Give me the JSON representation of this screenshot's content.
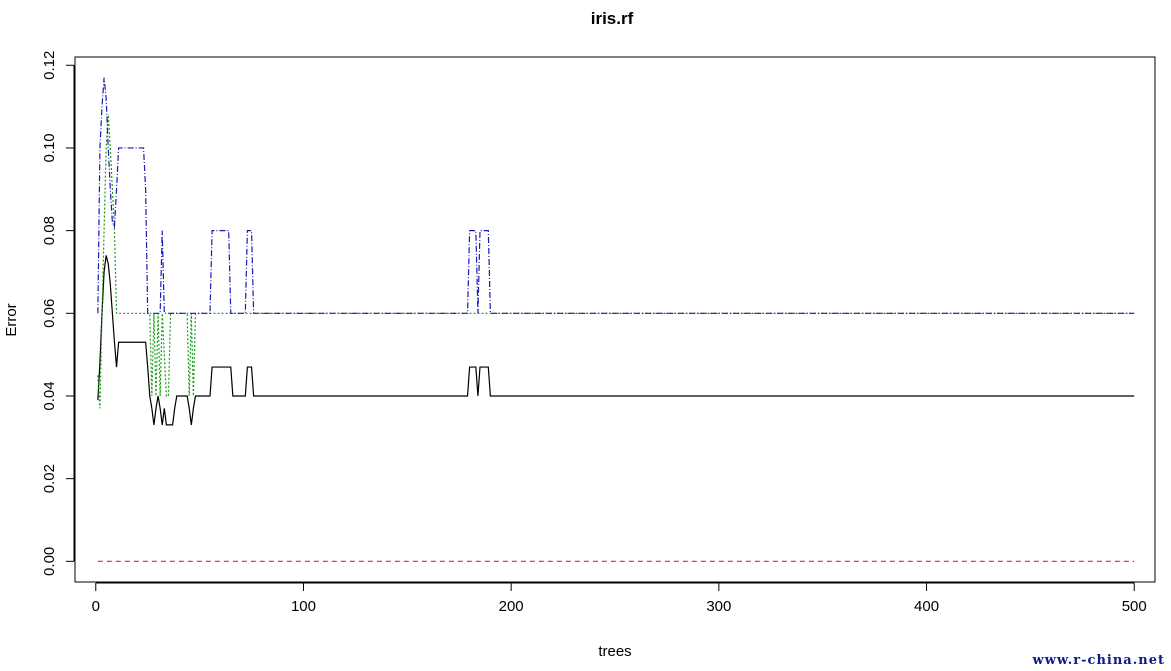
{
  "chart_data": {
    "type": "line",
    "title": "iris.rf",
    "xlabel": "trees",
    "ylabel": "Error",
    "xlim": [
      -10,
      510
    ],
    "ylim": [
      -0.005,
      0.122
    ],
    "xticks": [
      0,
      100,
      200,
      300,
      400,
      500
    ],
    "yticks": [
      0.0,
      0.02,
      0.04,
      0.06,
      0.08,
      0.1,
      0.12
    ],
    "grid": false,
    "series": [
      {
        "color": "#000000",
        "dash": "",
        "points": [
          [
            1,
            0.039
          ],
          [
            2,
            0.048
          ],
          [
            3,
            0.06
          ],
          [
            4,
            0.07
          ],
          [
            5,
            0.074
          ],
          [
            6,
            0.072
          ],
          [
            7,
            0.067
          ],
          [
            8,
            0.06
          ],
          [
            9,
            0.053
          ],
          [
            10,
            0.047
          ],
          [
            11,
            0.053
          ],
          [
            24,
            0.053
          ],
          [
            25,
            0.047
          ],
          [
            26,
            0.04
          ],
          [
            27,
            0.037
          ],
          [
            28,
            0.033
          ],
          [
            29,
            0.037
          ],
          [
            30,
            0.04
          ],
          [
            31,
            0.037
          ],
          [
            32,
            0.033
          ],
          [
            33,
            0.037
          ],
          [
            34,
            0.033
          ],
          [
            37,
            0.033
          ],
          [
            38,
            0.037
          ],
          [
            39,
            0.04
          ],
          [
            44,
            0.04
          ],
          [
            45,
            0.037
          ],
          [
            46,
            0.033
          ],
          [
            47,
            0.037
          ],
          [
            48,
            0.04
          ],
          [
            55,
            0.04
          ],
          [
            56,
            0.047
          ],
          [
            65,
            0.047
          ],
          [
            66,
            0.04
          ],
          [
            72,
            0.04
          ],
          [
            73,
            0.047
          ],
          [
            75,
            0.047
          ],
          [
            76,
            0.04
          ],
          [
            179,
            0.04
          ],
          [
            180,
            0.047
          ],
          [
            183,
            0.047
          ],
          [
            184,
            0.04
          ],
          [
            185,
            0.047
          ],
          [
            189,
            0.047
          ],
          [
            190,
            0.04
          ],
          [
            500,
            0.04
          ]
        ]
      },
      {
        "color": "#e8242c",
        "dash": "5,4",
        "points": [
          [
            1,
            0.0
          ],
          [
            500,
            0.0
          ]
        ]
      },
      {
        "color": "#1a9b1a",
        "dash": "2,2",
        "points": [
          [
            1,
            0.045
          ],
          [
            2,
            0.037
          ],
          [
            3,
            0.06
          ],
          [
            4,
            0.08
          ],
          [
            5,
            0.1
          ],
          [
            6,
            0.108
          ],
          [
            7,
            0.1
          ],
          [
            8,
            0.09
          ],
          [
            9,
            0.08
          ],
          [
            10,
            0.06
          ],
          [
            26,
            0.06
          ],
          [
            27,
            0.04
          ],
          [
            28,
            0.06
          ],
          [
            29,
            0.04
          ],
          [
            30,
            0.06
          ],
          [
            31,
            0.04
          ],
          [
            32,
            0.06
          ],
          [
            34,
            0.04
          ],
          [
            35,
            0.04
          ],
          [
            36,
            0.06
          ],
          [
            44,
            0.06
          ],
          [
            45,
            0.04
          ],
          [
            46,
            0.06
          ],
          [
            47,
            0.04
          ],
          [
            48,
            0.06
          ],
          [
            500,
            0.06
          ]
        ]
      },
      {
        "color": "#1a1ab8",
        "dash": "6,2,1,2",
        "points": [
          [
            1,
            0.06
          ],
          [
            2,
            0.1
          ],
          [
            3,
            0.11
          ],
          [
            4,
            0.117
          ],
          [
            5,
            0.112
          ],
          [
            6,
            0.1
          ],
          [
            7,
            0.09
          ],
          [
            8,
            0.082
          ],
          [
            9,
            0.081
          ],
          [
            10,
            0.09
          ],
          [
            11,
            0.1
          ],
          [
            23,
            0.1
          ],
          [
            24,
            0.09
          ],
          [
            25,
            0.06
          ],
          [
            31,
            0.06
          ],
          [
            32,
            0.08
          ],
          [
            33,
            0.06
          ],
          [
            55,
            0.06
          ],
          [
            56,
            0.08
          ],
          [
            64,
            0.08
          ],
          [
            65,
            0.06
          ],
          [
            72,
            0.06
          ],
          [
            73,
            0.08
          ],
          [
            75,
            0.08
          ],
          [
            76,
            0.06
          ],
          [
            179,
            0.06
          ],
          [
            180,
            0.08
          ],
          [
            183,
            0.08
          ],
          [
            184,
            0.06
          ],
          [
            185,
            0.08
          ],
          [
            189,
            0.08
          ],
          [
            190,
            0.06
          ],
          [
            500,
            0.06
          ]
        ]
      }
    ]
  },
  "watermark": "www.r-china.net"
}
